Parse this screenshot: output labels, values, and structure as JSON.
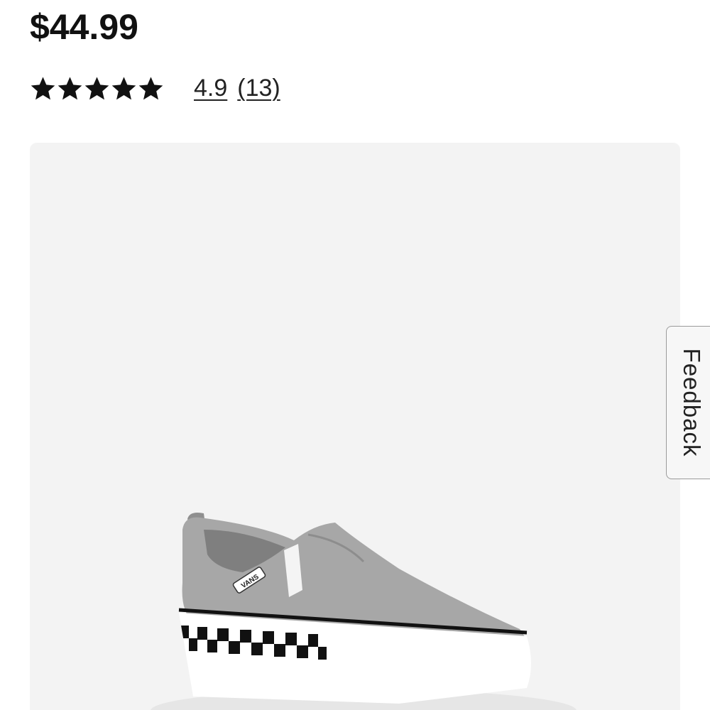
{
  "product": {
    "price": "$44.99",
    "rating": {
      "stars_filled": 5,
      "stars_total": 5,
      "value_label": "4.9",
      "count_label": "(13)"
    },
    "image": {
      "alt": "Gray canvas slip-on sneaker with checkerboard sidewall",
      "logo_text": "VANS"
    }
  },
  "feedback": {
    "label": "Feedback"
  },
  "colors": {
    "card_background": "#f3f3f3",
    "shoe_canvas": "#a7a7a7",
    "text": "#111111"
  }
}
